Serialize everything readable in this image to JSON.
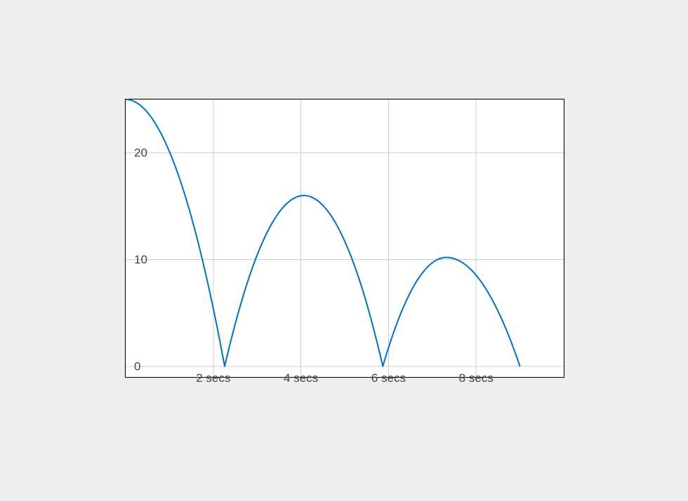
{
  "chart_data": {
    "type": "line",
    "xlabel": "",
    "ylabel": "",
    "title": "",
    "xlim": [
      0,
      10
    ],
    "ylim": [
      -1,
      25
    ],
    "x_ticks": [
      2,
      4,
      6,
      8
    ],
    "x_tick_labels": [
      "2 secs",
      "4 secs",
      "6 secs",
      "8 secs"
    ],
    "y_ticks": [
      0,
      10,
      20
    ],
    "y_tick_labels": [
      "0",
      "10",
      "20"
    ],
    "curve_description": "absolute value of a decaying oscillation (rectified bouncing-ball parabolic arcs)",
    "arcs": [
      {
        "t0": 0.0,
        "t1": 2.26,
        "peak_t": 0.0,
        "peak_y": 25.0
      },
      {
        "t0": 2.26,
        "t1": 5.87,
        "peak_t": 4.07,
        "peak_y": 16.0
      },
      {
        "t0": 5.87,
        "t1": 9.0,
        "peak_t": 7.32,
        "peak_y": 10.2
      }
    ],
    "series_end": {
      "t": 9.0,
      "y": 1.6
    }
  },
  "colors": {
    "series": "#0072bd",
    "grid": "#cccccc",
    "bg": "#eeeeee"
  }
}
